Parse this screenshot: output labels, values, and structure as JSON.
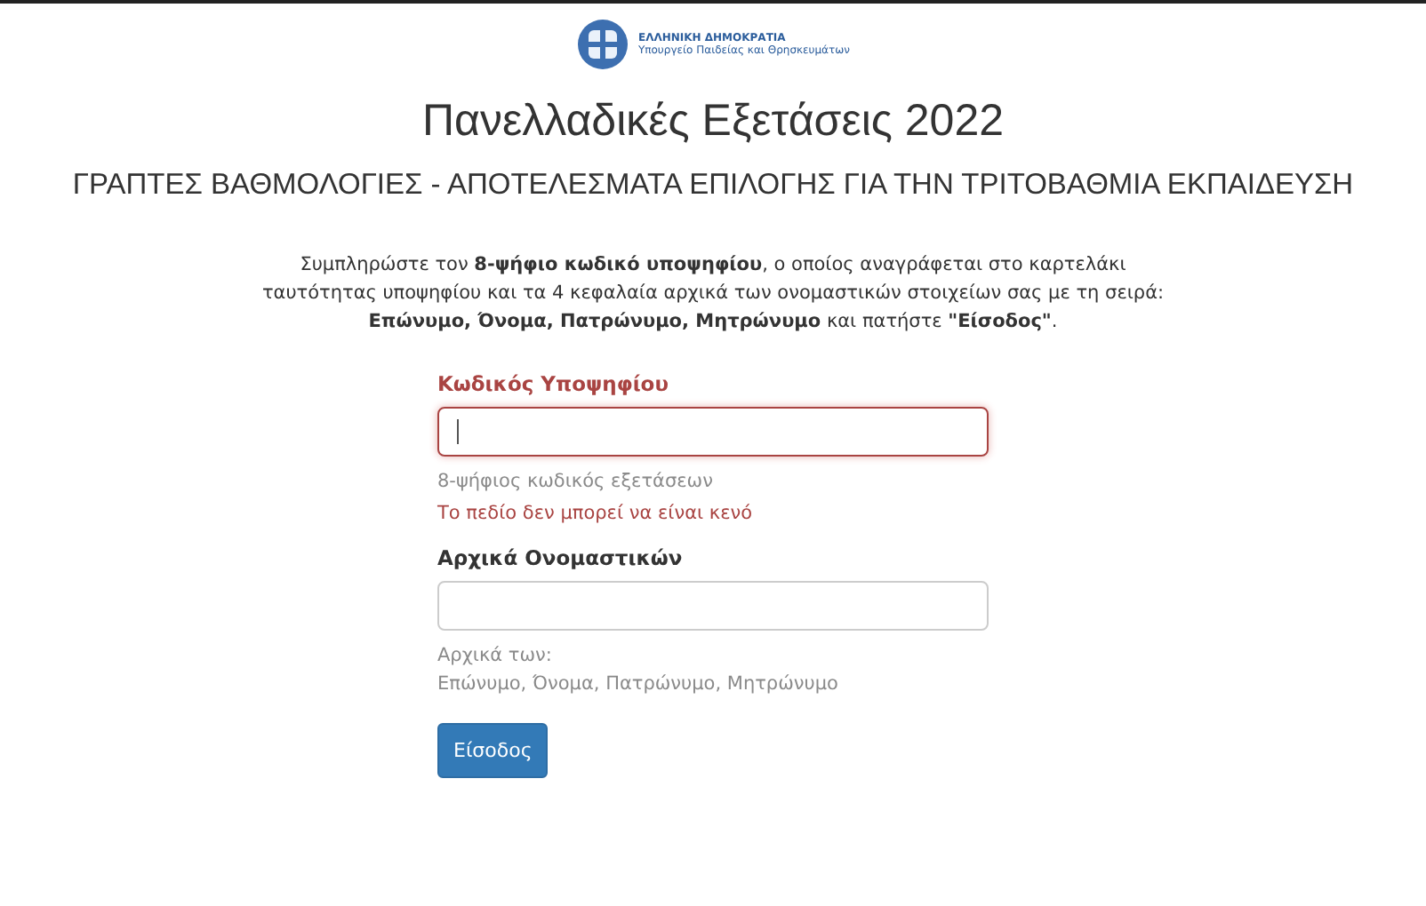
{
  "header": {
    "country": "ΕΛΛΗΝΙΚΗ ΔΗΜΟΚΡΑΤΙΑ",
    "ministry": "Υπουργείο Παιδείας και Θρησκευμάτων"
  },
  "title": "Πανελλαδικές Εξετάσεις 2022",
  "subtitle": "ΓΡΑΠΤΕΣ ΒΑΘΜΟΛΟΓΙΕΣ - ΑΠΟΤΕΛΕΣΜΑΤΑ ΕΠΙΛΟΓΗΣ ΓΙΑ ΤΗΝ ΤΡΙΤΟΒΑΘΜΙΑ ΕΚΠΑΙΔΕΥΣΗ",
  "instructions": [
    "Συμπληρώστε τον **8-ψήφιο κωδικό υποψηφίου**, ο οποίος αναγράφεται στο καρτελάκι",
    "ταυτότητας υποψηφίου και τα 4 κεφαλαία αρχικά των ονομαστικών στοιχείων σας με τη σειρά:",
    "**Επώνυμο, Όνομα, Πατρώνυμο, Μητρώνυμο** και πατήστε **\"Είσοδος\"**."
  ],
  "fields": [
    {
      "label": "Κωδικός Υποψηφίου",
      "focused": true,
      "has_error": true,
      "hint": [
        "8-ψήφιος κωδικός εξετάσεων"
      ],
      "error": "Το πεδίο δεν μπορεί να είναι κενό"
    },
    {
      "label": "Αρχικά Ονομαστικών",
      "focused": false,
      "has_error": false,
      "hint": [
        "Αρχικά των:",
        "Επώνυμο, Όνομα, Πατρώνυμο, Μητρώνυμο"
      ]
    }
  ],
  "submit_button": "Είσοδος"
}
